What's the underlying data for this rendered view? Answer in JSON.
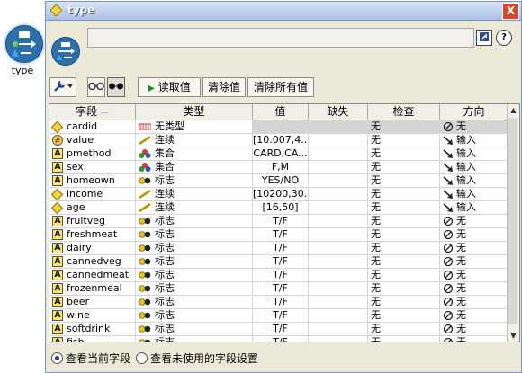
{
  "canvas_node": {
    "label": "type"
  },
  "window": {
    "title": "type",
    "close_label": "X"
  },
  "header": {
    "name_value": "",
    "help_label": "?"
  },
  "toolbar": {
    "read_values": "读取值",
    "clear_values": "清除值",
    "clear_all_values": "清除所有值"
  },
  "grid": {
    "columns": [
      "字段",
      "类型",
      "值",
      "缺失",
      "检查",
      "方向"
    ],
    "rows": [
      {
        "field": "cardid",
        "field_icon": "diamond-icon",
        "type": "无类型",
        "type_icon": "typeless-icon",
        "value": "",
        "missing": "",
        "check": "无",
        "direction": "无",
        "dir_icon": "none-icon"
      },
      {
        "field": "value",
        "field_icon": "ruler-field-icon",
        "type": "连续",
        "type_icon": "ruler-icon",
        "value": "[10.007,4...",
        "missing": "",
        "check": "无",
        "direction": "输入",
        "dir_icon": "arrow-icon"
      },
      {
        "field": "pmethod",
        "field_icon": "a-icon",
        "type": "集合",
        "type_icon": "set-icon",
        "value": "CARD,CA...",
        "missing": "",
        "check": "无",
        "direction": "输入",
        "dir_icon": "arrow-icon"
      },
      {
        "field": "sex",
        "field_icon": "a-icon",
        "type": "集合",
        "type_icon": "set-icon",
        "value": "F,M",
        "missing": "",
        "check": "无",
        "direction": "输入",
        "dir_icon": "arrow-icon"
      },
      {
        "field": "homeown",
        "field_icon": "a-icon",
        "type": "标志",
        "type_icon": "flag-icon",
        "value": "YES/NO",
        "missing": "",
        "check": "无",
        "direction": "输入",
        "dir_icon": "arrow-icon"
      },
      {
        "field": "income",
        "field_icon": "diamond-icon",
        "type": "连续",
        "type_icon": "ruler-icon",
        "value": "[10200,30...",
        "missing": "",
        "check": "无",
        "direction": "输入",
        "dir_icon": "arrow-icon"
      },
      {
        "field": "age",
        "field_icon": "diamond-icon",
        "type": "连续",
        "type_icon": "ruler-icon",
        "value": "[16,50]",
        "missing": "",
        "check": "无",
        "direction": "输入",
        "dir_icon": "arrow-icon"
      },
      {
        "field": "fruitveg",
        "field_icon": "a-icon",
        "type": "标志",
        "type_icon": "flag-icon",
        "value": "T/F",
        "missing": "",
        "check": "无",
        "direction": "无",
        "dir_icon": "none-icon"
      },
      {
        "field": "freshmeat",
        "field_icon": "a-icon",
        "type": "标志",
        "type_icon": "flag-icon",
        "value": "T/F",
        "missing": "",
        "check": "无",
        "direction": "无",
        "dir_icon": "none-icon"
      },
      {
        "field": "dairy",
        "field_icon": "a-icon",
        "type": "标志",
        "type_icon": "flag-icon",
        "value": "T/F",
        "missing": "",
        "check": "无",
        "direction": "无",
        "dir_icon": "none-icon"
      },
      {
        "field": "cannedveg",
        "field_icon": "a-icon",
        "type": "标志",
        "type_icon": "flag-icon",
        "value": "T/F",
        "missing": "",
        "check": "无",
        "direction": "无",
        "dir_icon": "none-icon"
      },
      {
        "field": "cannedmeat",
        "field_icon": "a-icon",
        "type": "标志",
        "type_icon": "flag-icon",
        "value": "T/F",
        "missing": "",
        "check": "无",
        "direction": "无",
        "dir_icon": "none-icon"
      },
      {
        "field": "frozenmeal",
        "field_icon": "a-icon",
        "type": "标志",
        "type_icon": "flag-icon",
        "value": "T/F",
        "missing": "",
        "check": "无",
        "direction": "无",
        "dir_icon": "none-icon"
      },
      {
        "field": "beer",
        "field_icon": "a-icon",
        "type": "标志",
        "type_icon": "flag-icon",
        "value": "T/F",
        "missing": "",
        "check": "无",
        "direction": "无",
        "dir_icon": "none-icon"
      },
      {
        "field": "wine",
        "field_icon": "a-icon",
        "type": "标志",
        "type_icon": "flag-icon",
        "value": "T/F",
        "missing": "",
        "check": "无",
        "direction": "无",
        "dir_icon": "none-icon"
      },
      {
        "field": "softdrink",
        "field_icon": "a-icon",
        "type": "标志",
        "type_icon": "flag-icon",
        "value": "T/F",
        "missing": "",
        "check": "无",
        "direction": "无",
        "dir_icon": "none-icon"
      },
      {
        "field": "fish",
        "field_icon": "a-icon",
        "type": "标志",
        "type_icon": "flag-icon",
        "value": "T/F",
        "missing": "",
        "check": "无",
        "direction": "无",
        "dir_icon": "none-icon"
      }
    ]
  },
  "footer": {
    "radio_current": "查看当前字段",
    "radio_unused": "查看未使用的字段设置",
    "selected": "current"
  }
}
